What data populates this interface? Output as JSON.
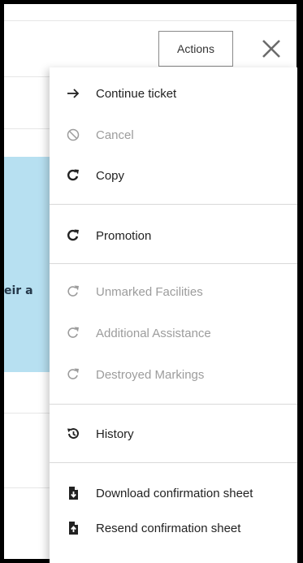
{
  "header": {
    "actions_label": "Actions"
  },
  "background": {
    "partial_text": "eir a"
  },
  "menu": {
    "items": [
      {
        "label": "Continue ticket",
        "icon": "arrow-right-icon",
        "enabled": true
      },
      {
        "label": "Cancel",
        "icon": "ban-icon",
        "enabled": false
      },
      {
        "label": "Copy",
        "icon": "redo-icon",
        "enabled": true
      },
      {
        "label": "Promotion",
        "icon": "redo-icon",
        "enabled": true
      },
      {
        "label": "Unmarked Facilities",
        "icon": "redo-icon",
        "enabled": false
      },
      {
        "label": "Additional Assistance",
        "icon": "redo-icon",
        "enabled": false
      },
      {
        "label": "Destroyed Markings",
        "icon": "redo-icon",
        "enabled": false
      },
      {
        "label": "History",
        "icon": "history-icon",
        "enabled": true
      },
      {
        "label": "Download confirmation sheet",
        "icon": "file-download-icon",
        "enabled": true
      },
      {
        "label": "Resend confirmation sheet",
        "icon": "file-upload-icon",
        "enabled": true
      }
    ]
  },
  "colors": {
    "panel_blue": "#b7e0f1",
    "text_enabled": "#222222",
    "text_disabled": "#9c9c9c"
  }
}
